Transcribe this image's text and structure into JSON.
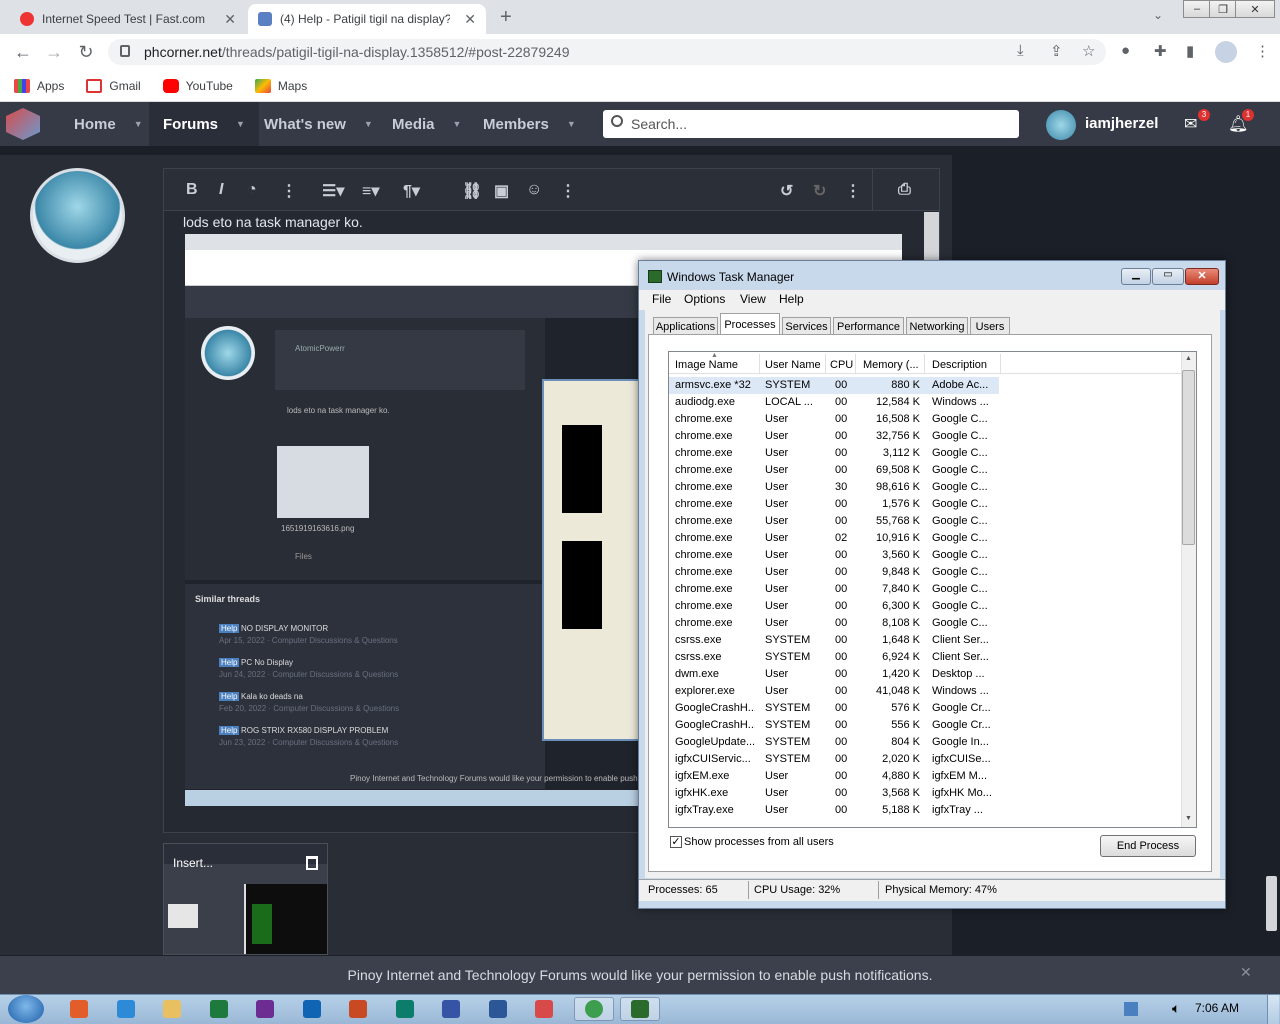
{
  "browser": {
    "tabs": [
      {
        "title": "Internet Speed Test | Fast.com",
        "active": false
      },
      {
        "title": "(4) Help - Patigil tigil na display?",
        "active": true
      }
    ],
    "new_tab": "+",
    "url_host": "phcorner.net",
    "url_path": "/threads/patigil-tigil-na-display.1358512/#post-22879249",
    "bookmarks": [
      "Apps",
      "Gmail",
      "YouTube",
      "Maps"
    ]
  },
  "site": {
    "nav": [
      "Home",
      "Forums",
      "What's new",
      "Media",
      "Members"
    ],
    "search_placeholder": "Search...",
    "username": "iamjherzel",
    "mail_badge": "3",
    "alert_badge": "1"
  },
  "editor": {
    "text": "lods eto na task manager ko.",
    "attachment_label": "Insert..."
  },
  "embedded": {
    "quote_author": "AtomicPowerr",
    "thumb_caption": "1651919163616.png",
    "files_label": "Files",
    "similar_title": "Similar threads",
    "similar": [
      {
        "badge": "Help",
        "title": "NO DISPLAY MONITOR",
        "meta": "Apr 15, 2022 · Computer Discussions & Questions"
      },
      {
        "badge": "Help",
        "title": "PC No Display",
        "meta": "Jun 24, 2022 · Computer Discussions & Questions"
      },
      {
        "badge": "Help",
        "title": "Kala ko deads na",
        "meta": "Feb 20, 2022 · Computer Discussions & Questions"
      },
      {
        "badge": "Help",
        "title": "ROG STRIX RX580 DISPLAY PROBLEM",
        "meta": "Jun 23, 2022 · Computer Discussions & Questions"
      }
    ],
    "push_text": "Pinoy Internet and Technology Forums would like your permission to enable push"
  },
  "taskmanager": {
    "title": "Windows Task Manager",
    "menu": [
      "File",
      "Options",
      "View",
      "Help"
    ],
    "tabs": [
      "Applications",
      "Processes",
      "Services",
      "Performance",
      "Networking",
      "Users"
    ],
    "active_tab": "Processes",
    "columns": [
      "Image Name",
      "User Name",
      "CPU",
      "Memory (...",
      "Description"
    ],
    "rows": [
      [
        "armsvc.exe *32",
        "SYSTEM",
        "00",
        "880 K",
        "Adobe Ac..."
      ],
      [
        "audiodg.exe",
        "LOCAL ...",
        "00",
        "12,584 K",
        "Windows ..."
      ],
      [
        "chrome.exe",
        "User",
        "00",
        "16,508 K",
        "Google C..."
      ],
      [
        "chrome.exe",
        "User",
        "00",
        "32,756 K",
        "Google C..."
      ],
      [
        "chrome.exe",
        "User",
        "00",
        "3,112 K",
        "Google C..."
      ],
      [
        "chrome.exe",
        "User",
        "00",
        "69,508 K",
        "Google C..."
      ],
      [
        "chrome.exe",
        "User",
        "30",
        "98,616 K",
        "Google C..."
      ],
      [
        "chrome.exe",
        "User",
        "00",
        "1,576 K",
        "Google C..."
      ],
      [
        "chrome.exe",
        "User",
        "00",
        "55,768 K",
        "Google C..."
      ],
      [
        "chrome.exe",
        "User",
        "02",
        "10,916 K",
        "Google C..."
      ],
      [
        "chrome.exe",
        "User",
        "00",
        "3,560 K",
        "Google C..."
      ],
      [
        "chrome.exe",
        "User",
        "00",
        "9,848 K",
        "Google C..."
      ],
      [
        "chrome.exe",
        "User",
        "00",
        "7,840 K",
        "Google C..."
      ],
      [
        "chrome.exe",
        "User",
        "00",
        "6,300 K",
        "Google C..."
      ],
      [
        "chrome.exe",
        "User",
        "00",
        "8,108 K",
        "Google C..."
      ],
      [
        "csrss.exe",
        "SYSTEM",
        "00",
        "1,648 K",
        "Client Ser..."
      ],
      [
        "csrss.exe",
        "SYSTEM",
        "00",
        "6,924 K",
        "Client Ser..."
      ],
      [
        "dwm.exe",
        "User",
        "00",
        "1,420 K",
        "Desktop ..."
      ],
      [
        "explorer.exe",
        "User",
        "00",
        "41,048 K",
        "Windows ..."
      ],
      [
        "GoogleCrashH...",
        "SYSTEM",
        "00",
        "576 K",
        "Google Cr..."
      ],
      [
        "GoogleCrashH...",
        "SYSTEM",
        "00",
        "556 K",
        "Google Cr..."
      ],
      [
        "GoogleUpdate...",
        "SYSTEM",
        "00",
        "804 K",
        "Google In..."
      ],
      [
        "igfxCUIServic...",
        "SYSTEM",
        "00",
        "2,020 K",
        "igfxCUISe..."
      ],
      [
        "igfxEM.exe",
        "User",
        "00",
        "4,880 K",
        "igfxEM M..."
      ],
      [
        "igfxHK.exe",
        "User",
        "00",
        "3,568 K",
        "igfxHK Mo..."
      ],
      [
        "igfxTray.exe",
        "User",
        "00",
        "5,188 K",
        "igfxTray ..."
      ]
    ],
    "show_all_label": "Show processes from all users",
    "show_all_checked": true,
    "end_process": "End Process",
    "status": {
      "processes": "Processes: 65",
      "cpu": "CPU Usage: 32%",
      "memory": "Physical Memory: 47%"
    }
  },
  "notification": "Pinoy Internet and Technology Forums would like your permission to enable push notifications.",
  "taskbar": {
    "clock": "7:06 AM",
    "apps": [
      "media-player",
      "ie",
      "explorer",
      "excel",
      "onenote",
      "outlook",
      "powerpoint",
      "publisher",
      "visio",
      "word",
      "paint",
      "chrome",
      "task-manager"
    ]
  }
}
